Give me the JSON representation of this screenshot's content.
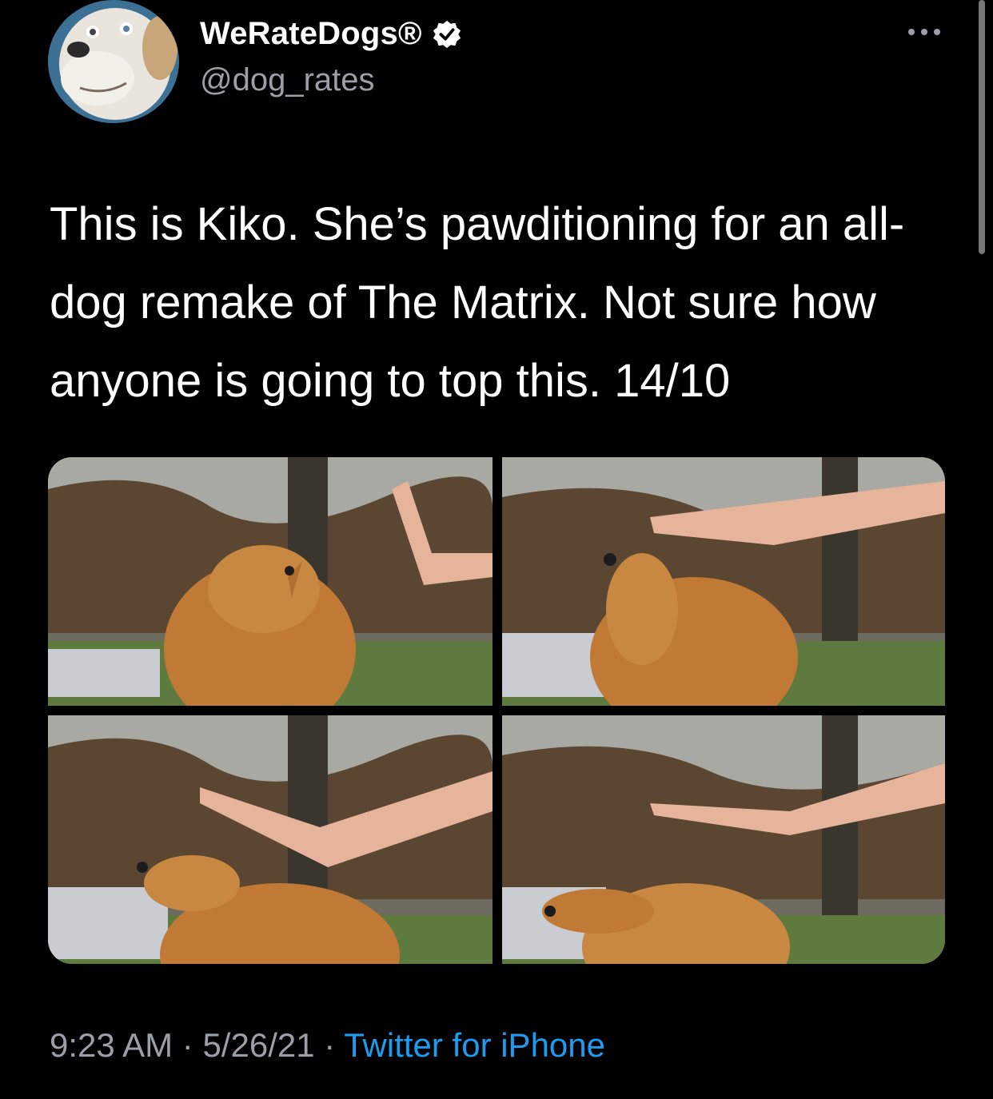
{
  "tweet": {
    "display_name": "WeRateDogs®",
    "handle": "@dog_rates",
    "text": "This is Kiko. She’s pawditioning for an all-dog remake of The Matrix. Not sure how anyone is going to top this. 14/10",
    "time": "9:23 AM",
    "separator": "·",
    "date": "5/26/21",
    "source": "Twitter for iPhone"
  },
  "icons": {
    "verified": "verified-badge-icon",
    "more": "more-options-icon"
  },
  "colors": {
    "background": "#000000",
    "text": "#ffffff",
    "secondary": "#9aa0a6",
    "link": "#1d9bf0"
  },
  "media": {
    "count": 4
  }
}
